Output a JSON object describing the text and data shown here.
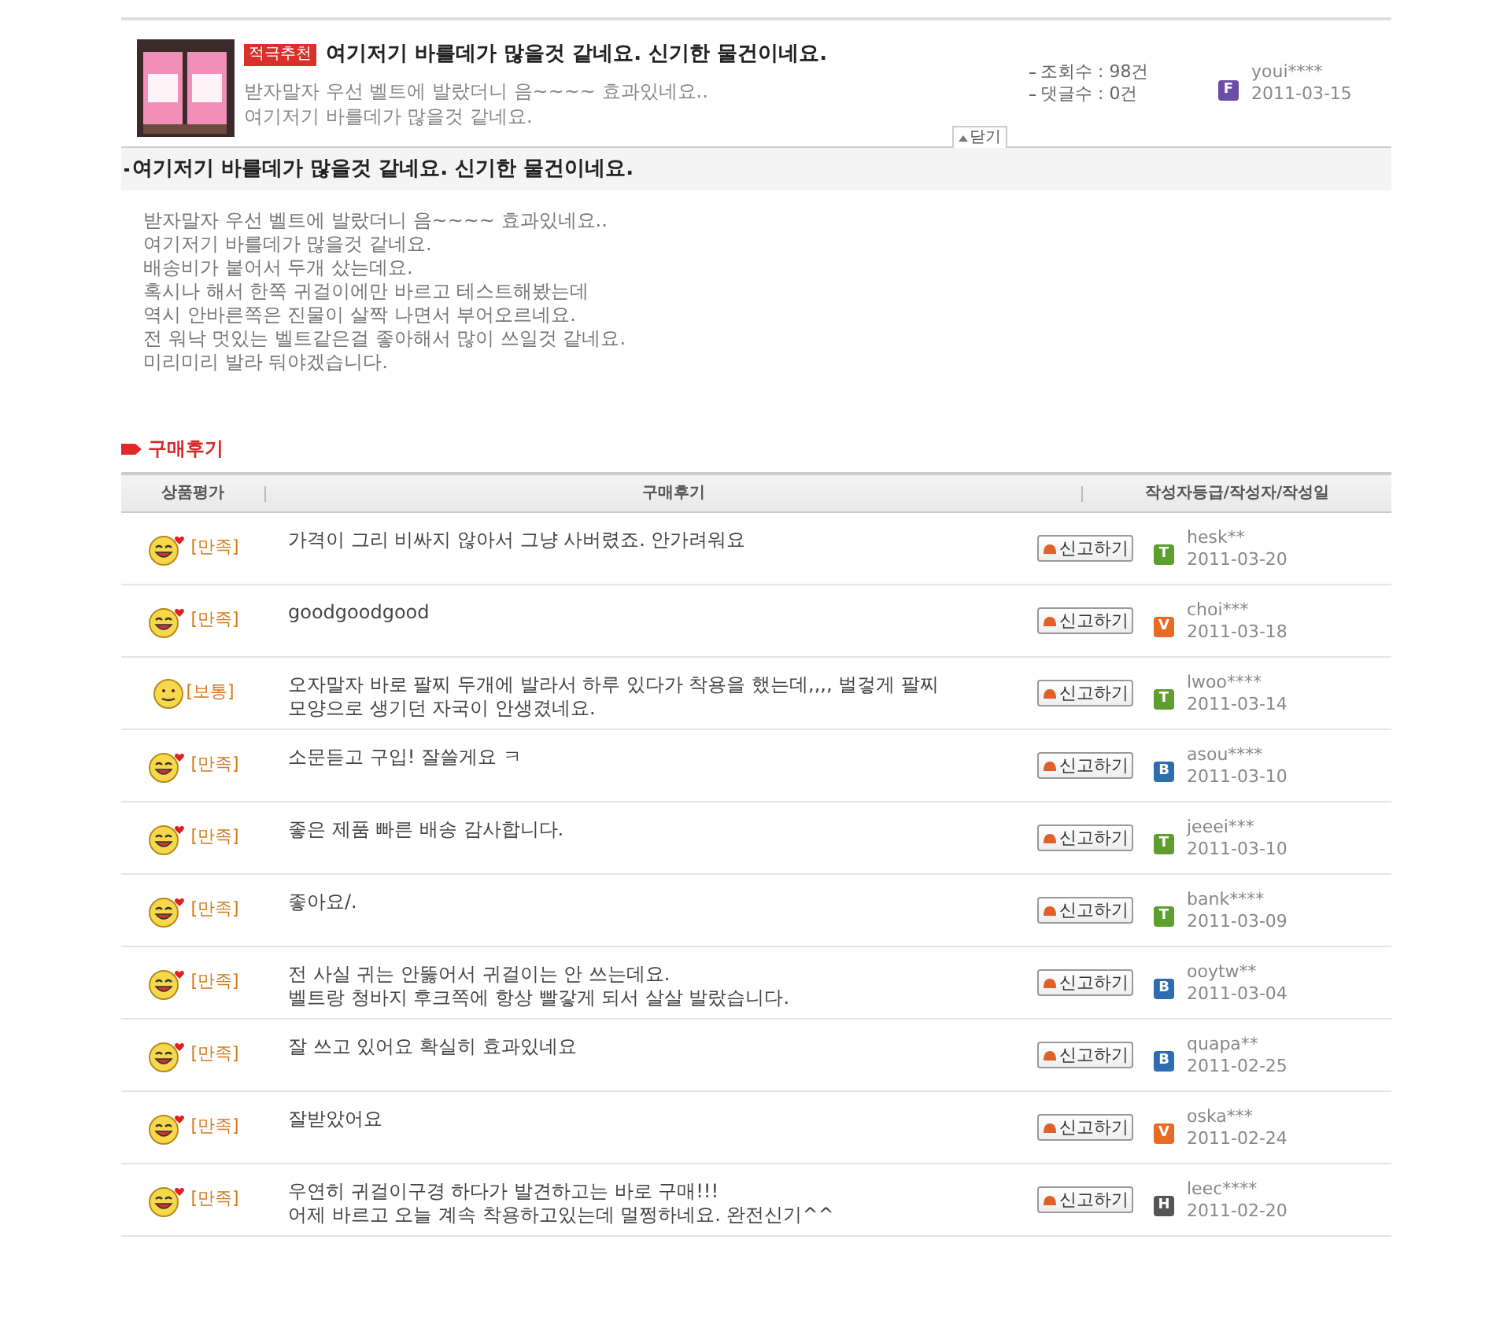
{
  "post": {
    "badge": "적극추천",
    "title": "여기저기 바를데가 많을것 같네요. 신기한 물건이네요.",
    "preview": [
      "받자말자 우선 벨트에 발랐더니 음~~~~ 효과있네요..",
      "여기저기 바를데가 많을것 같네요."
    ],
    "stats": [
      "조회수 : 98건",
      "댓글수 : 0건"
    ],
    "grade": {
      "letter": "F",
      "color": "#6a4ea6"
    },
    "author": "youi****",
    "date": "2011-03-15",
    "close_tab": "닫기"
  },
  "detail": {
    "title": "여기저기 바를데가 많을것 같네요. 신기한 물건이네요.",
    "lines": [
      "받자말자 우선 벨트에 발랐더니 음~~~~ 효과있네요..",
      "여기저기 바를데가 많을것 같네요.",
      "배송비가 붙어서 두개 샀는데요.",
      "혹시나 해서 한쪽 귀걸이에만 바르고 테스트해봤는데",
      "역시 안바른쪽은 진물이 살짝 나면서 부어오르네요.",
      "전 워낙 멋있는 벨트같은걸 좋아해서 많이 쓰일것 같네요.",
      "미리미리 발라 둬야겠습니다."
    ]
  },
  "reviews_section": {
    "title": "구매후기",
    "columns": [
      "상품평가",
      "구매후기",
      "작성자등급/작성자/작성일"
    ],
    "rows": [
      {
        "kind": "happy",
        "rating": "[만족]",
        "text": [
          "가격이 그리 비싸지 않아서 그냥 사버렸죠. 안가려워요"
        ],
        "report": "신고하기",
        "grade": {
          "letter": "T",
          "color": "#5e9e2e"
        },
        "author": "hesk**",
        "date": "2011-03-20"
      },
      {
        "kind": "happy",
        "rating": "[만족]",
        "text": [
          "goodgoodgood"
        ],
        "report": "신고하기",
        "grade": {
          "letter": "V",
          "color": "#e86a24"
        },
        "author": "choi***",
        "date": "2011-03-18"
      },
      {
        "kind": "neutral",
        "rating": "[보통]",
        "text": [
          "오자말자 바로 팔찌 두개에 발라서 하루 있다가 착용을 했는데,,,, 벌겋게 팔찌",
          "모양으로 생기던 자국이  안생겼네요."
        ],
        "report": "신고하기",
        "grade": {
          "letter": "T",
          "color": "#5e9e2e"
        },
        "author": "lwoo****",
        "date": "2011-03-14"
      },
      {
        "kind": "happy",
        "rating": "[만족]",
        "text": [
          "소문듣고 구입! 잘쓸게요 ㅋ"
        ],
        "report": "신고하기",
        "grade": {
          "letter": "B",
          "color": "#2f6db3"
        },
        "author": "asou****",
        "date": "2011-03-10"
      },
      {
        "kind": "happy",
        "rating": "[만족]",
        "text": [
          "좋은 제품 빠른 배송 감사합니다."
        ],
        "report": "신고하기",
        "grade": {
          "letter": "T",
          "color": "#5e9e2e"
        },
        "author": "jeeei***",
        "date": "2011-03-10"
      },
      {
        "kind": "happy",
        "rating": "[만족]",
        "text": [
          "좋아요/."
        ],
        "report": "신고하기",
        "grade": {
          "letter": "T",
          "color": "#5e9e2e"
        },
        "author": "bank****",
        "date": "2011-03-09"
      },
      {
        "kind": "happy",
        "rating": "[만족]",
        "text": [
          "전 사실 귀는 안뚫어서 귀걸이는 안 쓰는데요.",
          "벨트랑 청바지 후크쪽에 항상 빨갛게 되서 살살 발랐습니다."
        ],
        "report": "신고하기",
        "grade": {
          "letter": "B",
          "color": "#2f6db3"
        },
        "author": "ooytw**",
        "date": "2011-03-04"
      },
      {
        "kind": "happy",
        "rating": "[만족]",
        "text": [
          "잘 쓰고 있어요 확실히 효과있네요"
        ],
        "report": "신고하기",
        "grade": {
          "letter": "B",
          "color": "#2f6db3"
        },
        "author": "quapa**",
        "date": "2011-02-25"
      },
      {
        "kind": "happy",
        "rating": "[만족]",
        "text": [
          "잘받았어요"
        ],
        "report": "신고하기",
        "grade": {
          "letter": "V",
          "color": "#e86a24"
        },
        "author": "oska***",
        "date": "2011-02-24"
      },
      {
        "kind": "happy",
        "rating": "[만족]",
        "text": [
          "우연히 귀걸이구경 하다가 발견하고는 바로 구매!!!",
          "어제 바르고 오늘 계속 착용하고있는데 멀쩡하네요. 완전신기^^"
        ],
        "report": "신고하기",
        "grade": {
          "letter": "H",
          "color": "#555555"
        },
        "author": "leec****",
        "date": "2011-02-20"
      }
    ]
  }
}
